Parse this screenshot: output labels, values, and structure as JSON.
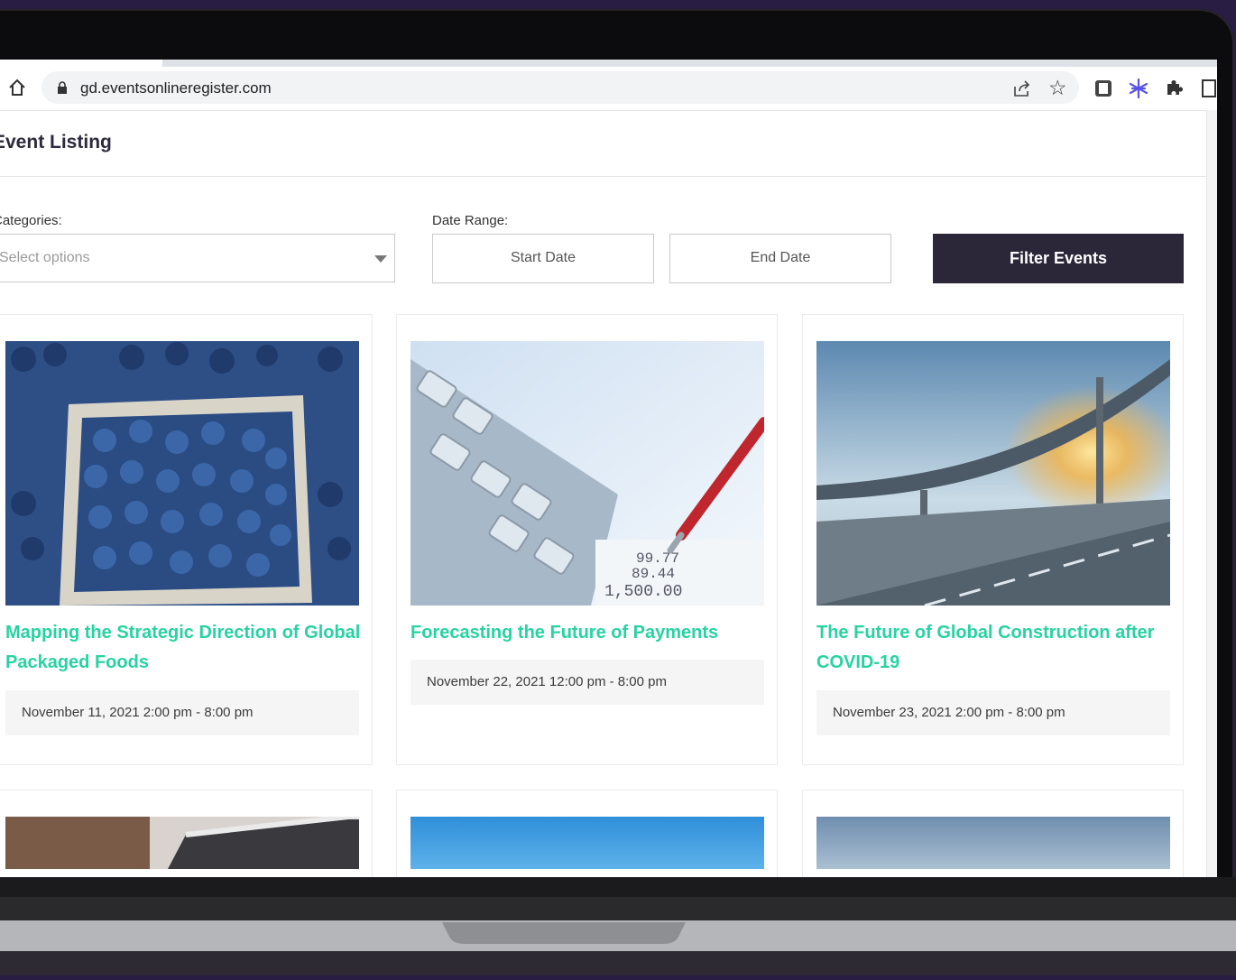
{
  "browser": {
    "url": "gd.eventsonlineregister.com"
  },
  "page": {
    "title": "Event Listing"
  },
  "filters": {
    "categories_label": "Categories:",
    "categories_placeholder": "Select options",
    "date_range_label": "Date Range:",
    "start_date_placeholder": "Start Date",
    "end_date_placeholder": "End Date",
    "filter_button": "Filter Events"
  },
  "events": [
    {
      "title": "Mapping the Strategic Direction of Global Packaged Foods",
      "date": "November 11, 2021 2:00 pm - 8:00 pm",
      "image": "blueberries-photo"
    },
    {
      "title": "Forecasting the Future of Payments",
      "date": "November 22, 2021 12:00 pm - 8:00 pm",
      "image": "calculator-pen-photo"
    },
    {
      "title": "The Future of Global Construction after COVID-19",
      "date": "November 23, 2021 2:00 pm - 8:00 pm",
      "image": "highway-overpass-photo"
    }
  ],
  "colors": {
    "accent": "#27d3a2",
    "button_bg": "#2b2638",
    "outer_bg": "#2a1d44"
  }
}
